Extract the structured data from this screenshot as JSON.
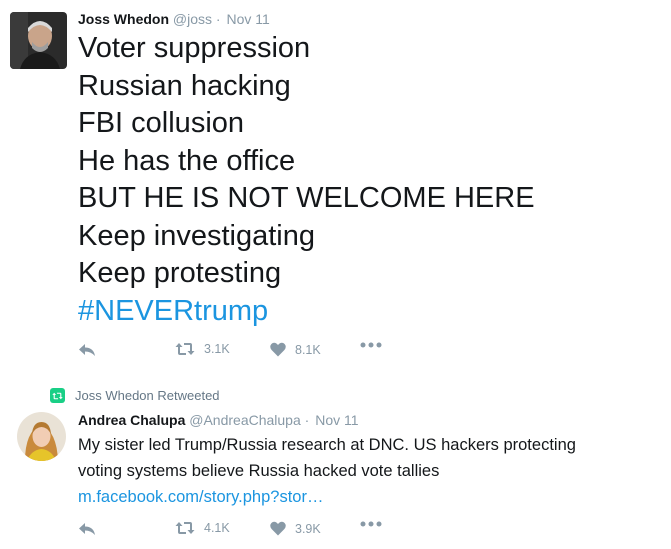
{
  "tweet1": {
    "author_name": "Joss Whedon",
    "handle": "@joss",
    "separator": "·",
    "date": "Nov 11",
    "lines": [
      "Voter suppression",
      "Russian hacking",
      "FBI collusion",
      "He has the office",
      "BUT HE IS NOT WELCOME HERE",
      "Keep investigating",
      "Keep protesting"
    ],
    "hashtag": "#NEVERtrump",
    "retweet_count": "3.1K",
    "like_count": "8.1K"
  },
  "tweet2": {
    "retweet_context": "Joss Whedon Retweeted",
    "author_name": "Andrea Chalupa",
    "handle": "@AndreaChalupa",
    "separator": "·",
    "date": "Nov 11",
    "text_line1": "My sister led Trump/Russia research at DNC. US hackers protecting",
    "text_line2": "voting systems believe Russia hacked vote tallies",
    "link": "m.facebook.com/story.php?stor…",
    "retweet_count": "4.1K",
    "like_count": "3.9K"
  },
  "colors": {
    "link": "#1b95e0",
    "meta": "#8899a6",
    "retweet_green": "#19cf86"
  },
  "icons": [
    "reply-icon",
    "retweet-icon",
    "heart-icon",
    "more-icon"
  ]
}
